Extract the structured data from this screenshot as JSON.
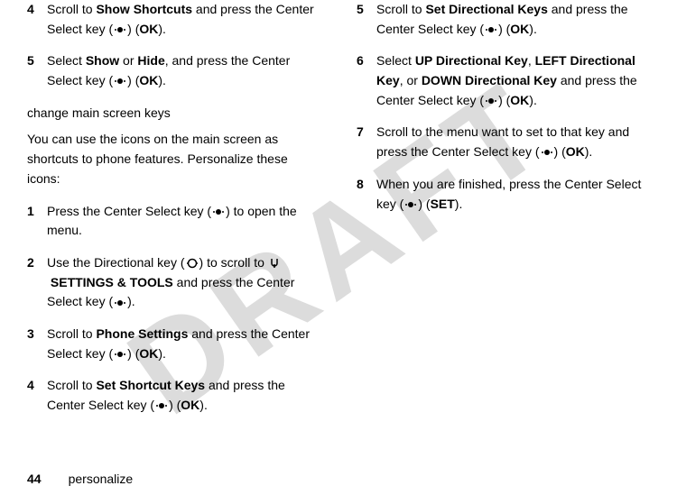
{
  "watermark": "DRAFT",
  "left": {
    "step4_pre": "Scroll to ",
    "step4_b1": "Show Shortcuts",
    "step4_post1": " and press the Center Select key (",
    "step4_ok": "OK",
    "step4_post2": ").",
    "step5_pre": "Select ",
    "step5_b1": "Show",
    "step5_mid1": " or ",
    "step5_b2": "Hide",
    "step5_post1": ", and press the Center Select key (",
    "step5_ok": "OK",
    "step5_post2": ").",
    "heading": "change main screen keys",
    "intro": "You can use the icons on the main screen as shortcuts to phone features. Personalize these icons:",
    "s1_pre": "Press the Center Select key (",
    "s1_post": ") to open the menu.",
    "s2_pre": "Use the Directional key (",
    "s2_mid1": ") to scroll to ",
    "s2_b1": "SETTINGS & TOOLS",
    "s2_post1": " and press the Center Select key (",
    "s2_post2": ").",
    "s3_pre": "Scroll to ",
    "s3_b1": "Phone Settings",
    "s3_post1": " and press the Center Select key (",
    "s3_ok": "OK",
    "s3_post2": ").",
    "s4b_pre": "Scroll to ",
    "s4b_b1": "Set Shortcut Keys",
    "s4b_post1": " and press the Center Select key (",
    "s4b_ok": "OK",
    "s4b_post2": ")."
  },
  "right": {
    "s5_pre": "Scroll to ",
    "s5_b1": "Set Directional Keys",
    "s5_post1": " and press the Center Select key (",
    "s5_ok": "OK",
    "s5_post2": ").",
    "s6_pre": "Select ",
    "s6_b1": "UP Directional Key",
    "s6_mid1": ", ",
    "s6_b2": "LEFT Directional Key",
    "s6_mid2": ", or ",
    "s6_b3": "DOWN Directional Key",
    "s6_post1": " and press the Center Select key (",
    "s6_ok": "OK",
    "s6_post2": ").",
    "s7_pre": "Scroll to the menu want to set to that key and press the Center Select key (",
    "s7_ok": "OK",
    "s7_post2": ").",
    "s8_pre": "When you are finished, press the Center Select key (",
    "s8_set": "SET",
    "s8_post2": ")."
  },
  "footer": {
    "page": "44",
    "section": "personalize"
  },
  "nums": {
    "n1": "1",
    "n2": "2",
    "n3": "3",
    "n4": "4",
    "n5": "5",
    "n6": "6",
    "n7": "7",
    "n8": "8"
  }
}
